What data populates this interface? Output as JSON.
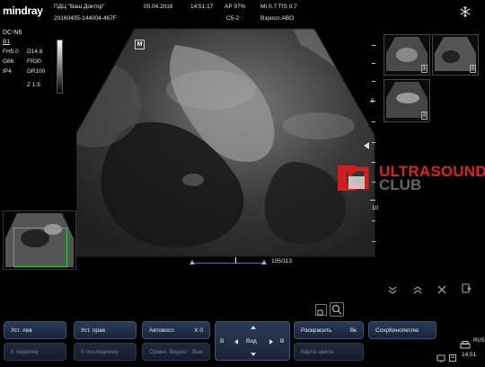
{
  "header": {
    "brand": "mindray",
    "clinic": "ПДЦ \"Ваш Доктор\"",
    "patient_id": "20160405-144004-467F",
    "date": "05.04.2016",
    "time": "14:51:17",
    "ap": "AP  97%",
    "mi_tis": "MI 0.7  TIS 0.7",
    "probe": "C5-2",
    "preset": "Взросл.ABO"
  },
  "params": {
    "mode": "DC-N6",
    "b_label": "B1",
    "rows": [
      {
        "left": "FH5.0",
        "right": "D14.8"
      },
      {
        "left": "G66",
        "right": "FR30"
      },
      {
        "left": "IP4",
        "right": "DR100"
      },
      {
        "left": "",
        "right": "Z 1.5"
      }
    ]
  },
  "scale": {
    "labels": [
      "5",
      "10"
    ]
  },
  "frame_counter": "105/113",
  "marker": "M",
  "thumbnails": [
    {
      "num": "1"
    },
    {
      "num": "2"
    },
    {
      "num": "3"
    }
  ],
  "watermark": {
    "word1": "ULTRASOUND",
    "word2": "CLUB"
  },
  "controls": {
    "row1": [
      {
        "label": "Уст. лев",
        "value": "",
        "enabled": true
      },
      {
        "label": "Уст. прав",
        "value": "",
        "enabled": true
      },
      {
        "label": "Автовосп",
        "value": "X 0",
        "enabled": true
      },
      {
        "label": "Раскрасить",
        "value": "Вк",
        "enabled": true
      },
      {
        "label": "СохрКинопетлю",
        "value": "",
        "enabled": true
      }
    ],
    "row2": [
      {
        "label": "К первому",
        "value": "",
        "enabled": false
      },
      {
        "label": "К последнему",
        "value": "",
        "enabled": false
      },
      {
        "label": "Сравн. Видео",
        "value": "Вык",
        "enabled": false
      },
      {
        "label": "Карта цвета",
        "value": "",
        "enabled": false
      }
    ],
    "nav": {
      "left": "B",
      "center": "Вид",
      "right": "B"
    }
  },
  "status": {
    "clock": "14:51",
    "lang": "RUS"
  },
  "colors": {
    "button": "#24334d",
    "accent": "#d22222",
    "roi": "#2ecc40"
  }
}
